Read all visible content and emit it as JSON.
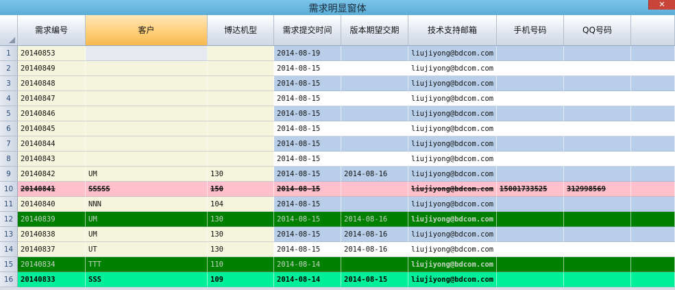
{
  "window": {
    "title": "需求明显窗体",
    "close_label": "✕"
  },
  "columns": [
    "需求编号",
    "客户",
    "博达机型",
    "需求提交时间",
    "版本期望交期",
    "技术支持邮箱",
    "手机号码",
    "QQ号码",
    ""
  ],
  "selected_column": 1,
  "rows": [
    {
      "n": "1",
      "id": "20140853",
      "cust": "",
      "model": "",
      "submit": "2014-08-19",
      "expect": "",
      "email": "liujiyong@bdcom.com",
      "phone": "",
      "qq": "",
      "style": "blue"
    },
    {
      "n": "2",
      "id": "20140849",
      "cust": "",
      "model": "",
      "submit": "2014-08-15",
      "expect": "",
      "email": "liujiyong@bdcom.com",
      "phone": "",
      "qq": "",
      "style": "white"
    },
    {
      "n": "3",
      "id": "20140848",
      "cust": "",
      "model": "",
      "submit": "2014-08-15",
      "expect": "",
      "email": "liujiyong@bdcom.com",
      "phone": "",
      "qq": "",
      "style": "blue"
    },
    {
      "n": "4",
      "id": "20140847",
      "cust": "",
      "model": "",
      "submit": "2014-08-15",
      "expect": "",
      "email": "liujiyong@bdcom.com",
      "phone": "",
      "qq": "",
      "style": "white"
    },
    {
      "n": "5",
      "id": "20140846",
      "cust": "",
      "model": "",
      "submit": "2014-08-15",
      "expect": "",
      "email": "liujiyong@bdcom.com",
      "phone": "",
      "qq": "",
      "style": "blue"
    },
    {
      "n": "6",
      "id": "20140845",
      "cust": "",
      "model": "",
      "submit": "2014-08-15",
      "expect": "",
      "email": "liujiyong@bdcom.com",
      "phone": "",
      "qq": "",
      "style": "white"
    },
    {
      "n": "7",
      "id": "20140844",
      "cust": "",
      "model": "",
      "submit": "2014-08-15",
      "expect": "",
      "email": "liujiyong@bdcom.com",
      "phone": "",
      "qq": "",
      "style": "blue"
    },
    {
      "n": "8",
      "id": "20140843",
      "cust": "",
      "model": "",
      "submit": "2014-08-15",
      "expect": "",
      "email": "liujiyong@bdcom.com",
      "phone": "",
      "qq": "",
      "style": "white"
    },
    {
      "n": "9",
      "id": "20140842",
      "cust": "UM",
      "model": "130",
      "submit": "2014-08-15",
      "expect": "2014-08-16",
      "email": "liujiyong@bdcom.com",
      "phone": "",
      "qq": "",
      "style": "blue"
    },
    {
      "n": "10",
      "id": "20140841",
      "cust": "SSSSS",
      "model": "150",
      "submit": "2014-08-15",
      "expect": "",
      "email": "liujiyong@bdcom.com",
      "phone": "15001733525",
      "qq": "312998569",
      "style": "pink"
    },
    {
      "n": "11",
      "id": "20140840",
      "cust": "NNN",
      "model": "104",
      "submit": "2014-08-15",
      "expect": "",
      "email": "liujiyong@bdcom.com",
      "phone": "",
      "qq": "",
      "style": "blue"
    },
    {
      "n": "12",
      "id": "20140839",
      "cust": "UM",
      "model": "130",
      "submit": "2014-08-15",
      "expect": "2014-08-16",
      "email": "liujiyong@bdcom.com",
      "phone": "",
      "qq": "",
      "style": "green"
    },
    {
      "n": "13",
      "id": "20140838",
      "cust": "UM",
      "model": "130",
      "submit": "2014-08-15",
      "expect": "2014-08-16",
      "email": "liujiyong@bdcom.com",
      "phone": "",
      "qq": "",
      "style": "blue"
    },
    {
      "n": "14",
      "id": "20140837",
      "cust": "UT",
      "model": "130",
      "submit": "2014-08-15",
      "expect": "2014-08-16",
      "email": "liujiyong@bdcom.com",
      "phone": "",
      "qq": "",
      "style": "white"
    },
    {
      "n": "15",
      "id": "20140834",
      "cust": "TTT",
      "model": "110",
      "submit": "2014-08-14",
      "expect": "",
      "email": "liujiyong@bdcom.com",
      "phone": "",
      "qq": "",
      "style": "green"
    },
    {
      "n": "16",
      "id": "20140833",
      "cust": "SSS",
      "model": "109",
      "submit": "2014-08-14",
      "expect": "2014-08-15",
      "email": "liujiyong@bdcom.com",
      "phone": "",
      "qq": "",
      "style": "mint"
    }
  ]
}
